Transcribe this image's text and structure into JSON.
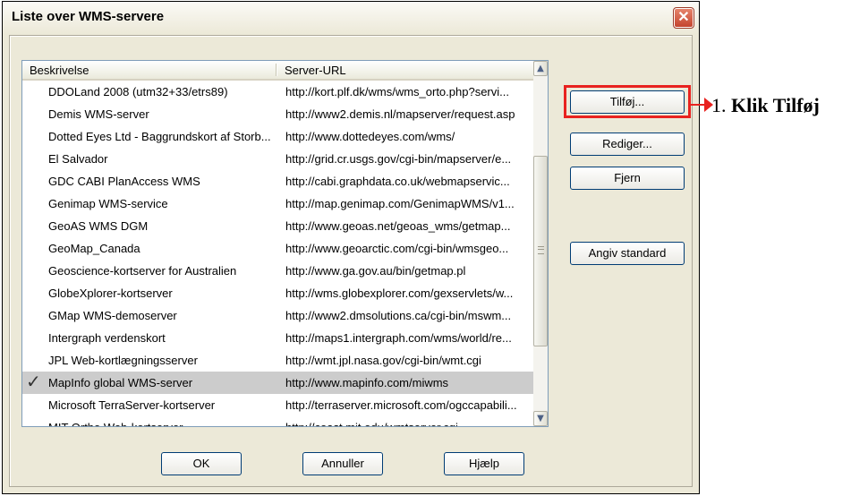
{
  "dialog": {
    "title": "Liste over WMS-servere",
    "close_symbol": "✕"
  },
  "list": {
    "columns": [
      "Beskrivelse",
      "Server-URL"
    ],
    "rows": [
      {
        "description": "DDOLand 2008 (utm32+33/etrs89)",
        "url": "http://kort.plf.dk/wms/wms_orto.php?servi...",
        "selected": false,
        "checked": false
      },
      {
        "description": "Demis WMS-server",
        "url": "http://www2.demis.nl/mapserver/request.asp",
        "selected": false,
        "checked": false
      },
      {
        "description": "Dotted Eyes Ltd - Baggrundskort af Storb...",
        "url": "http://www.dottedeyes.com/wms/",
        "selected": false,
        "checked": false
      },
      {
        "description": "El Salvador",
        "url": "http://grid.cr.usgs.gov/cgi-bin/mapserver/e...",
        "selected": false,
        "checked": false
      },
      {
        "description": "GDC CABI PlanAccess WMS",
        "url": "http://cabi.graphdata.co.uk/webmapservic...",
        "selected": false,
        "checked": false
      },
      {
        "description": "Genimap WMS-service",
        "url": "http://map.genimap.com/GenimapWMS/v1...",
        "selected": false,
        "checked": false
      },
      {
        "description": "GeoAS WMS DGM",
        "url": "http://www.geoas.net/geoas_wms/getmap...",
        "selected": false,
        "checked": false
      },
      {
        "description": "GeoMap_Canada",
        "url": "http://www.geoarctic.com/cgi-bin/wmsgeo...",
        "selected": false,
        "checked": false
      },
      {
        "description": "Geoscience-kortserver for Australien",
        "url": "http://www.ga.gov.au/bin/getmap.pl",
        "selected": false,
        "checked": false
      },
      {
        "description": "GlobeXplorer-kortserver",
        "url": "http://wms.globexplorer.com/gexservlets/w...",
        "selected": false,
        "checked": false
      },
      {
        "description": "GMap WMS-demoserver",
        "url": "http://www2.dmsolutions.ca/cgi-bin/mswm...",
        "selected": false,
        "checked": false
      },
      {
        "description": "Intergraph verdenskort",
        "url": "http://maps1.intergraph.com/wms/world/re...",
        "selected": false,
        "checked": false
      },
      {
        "description": "JPL Web-kortlægningsserver",
        "url": "http://wmt.jpl.nasa.gov/cgi-bin/wmt.cgi",
        "selected": false,
        "checked": false
      },
      {
        "description": "MapInfo global WMS-server",
        "url": "http://www.mapinfo.com/miwms",
        "selected": true,
        "checked": true
      },
      {
        "description": "Microsoft TerraServer-kortserver",
        "url": "http://terraserver.microsoft.com/ogccapabili...",
        "selected": false,
        "checked": false
      },
      {
        "description": "MIT Ortho Web-kortserver",
        "url": "http://coast.mit.edu/wmtserver.cgi",
        "selected": false,
        "checked": false
      }
    ]
  },
  "buttons": {
    "add": "Tilføj...",
    "edit": "Rediger...",
    "remove": "Fjern",
    "set_default": "Angiv standard",
    "ok": "OK",
    "cancel": "Annuller",
    "help": "Hjælp"
  },
  "annotation": {
    "number": "1. ",
    "text": "Klik Tilføj",
    "color": "#e8221f"
  },
  "scrollbar": {
    "up_symbol": "▲",
    "down_symbol": "▼"
  }
}
